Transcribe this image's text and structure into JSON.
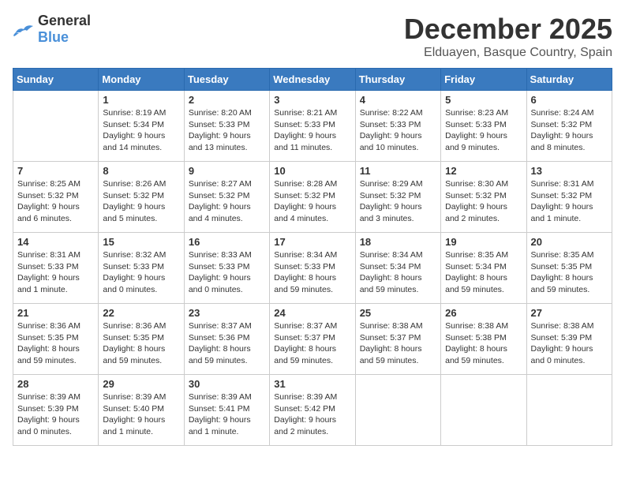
{
  "header": {
    "logo_general": "General",
    "logo_blue": "Blue",
    "month_title": "December 2025",
    "location": "Elduayen, Basque Country, Spain"
  },
  "days_of_week": [
    "Sunday",
    "Monday",
    "Tuesday",
    "Wednesday",
    "Thursday",
    "Friday",
    "Saturday"
  ],
  "weeks": [
    [
      {
        "day": "",
        "info": ""
      },
      {
        "day": "1",
        "info": "Sunrise: 8:19 AM\nSunset: 5:34 PM\nDaylight: 9 hours\nand 14 minutes."
      },
      {
        "day": "2",
        "info": "Sunrise: 8:20 AM\nSunset: 5:33 PM\nDaylight: 9 hours\nand 13 minutes."
      },
      {
        "day": "3",
        "info": "Sunrise: 8:21 AM\nSunset: 5:33 PM\nDaylight: 9 hours\nand 11 minutes."
      },
      {
        "day": "4",
        "info": "Sunrise: 8:22 AM\nSunset: 5:33 PM\nDaylight: 9 hours\nand 10 minutes."
      },
      {
        "day": "5",
        "info": "Sunrise: 8:23 AM\nSunset: 5:33 PM\nDaylight: 9 hours\nand 9 minutes."
      },
      {
        "day": "6",
        "info": "Sunrise: 8:24 AM\nSunset: 5:32 PM\nDaylight: 9 hours\nand 8 minutes."
      }
    ],
    [
      {
        "day": "7",
        "info": "Sunrise: 8:25 AM\nSunset: 5:32 PM\nDaylight: 9 hours\nand 6 minutes."
      },
      {
        "day": "8",
        "info": "Sunrise: 8:26 AM\nSunset: 5:32 PM\nDaylight: 9 hours\nand 5 minutes."
      },
      {
        "day": "9",
        "info": "Sunrise: 8:27 AM\nSunset: 5:32 PM\nDaylight: 9 hours\nand 4 minutes."
      },
      {
        "day": "10",
        "info": "Sunrise: 8:28 AM\nSunset: 5:32 PM\nDaylight: 9 hours\nand 4 minutes."
      },
      {
        "day": "11",
        "info": "Sunrise: 8:29 AM\nSunset: 5:32 PM\nDaylight: 9 hours\nand 3 minutes."
      },
      {
        "day": "12",
        "info": "Sunrise: 8:30 AM\nSunset: 5:32 PM\nDaylight: 9 hours\nand 2 minutes."
      },
      {
        "day": "13",
        "info": "Sunrise: 8:31 AM\nSunset: 5:32 PM\nDaylight: 9 hours\nand 1 minute."
      }
    ],
    [
      {
        "day": "14",
        "info": "Sunrise: 8:31 AM\nSunset: 5:33 PM\nDaylight: 9 hours\nand 1 minute."
      },
      {
        "day": "15",
        "info": "Sunrise: 8:32 AM\nSunset: 5:33 PM\nDaylight: 9 hours\nand 0 minutes."
      },
      {
        "day": "16",
        "info": "Sunrise: 8:33 AM\nSunset: 5:33 PM\nDaylight: 9 hours\nand 0 minutes."
      },
      {
        "day": "17",
        "info": "Sunrise: 8:34 AM\nSunset: 5:33 PM\nDaylight: 8 hours\nand 59 minutes."
      },
      {
        "day": "18",
        "info": "Sunrise: 8:34 AM\nSunset: 5:34 PM\nDaylight: 8 hours\nand 59 minutes."
      },
      {
        "day": "19",
        "info": "Sunrise: 8:35 AM\nSunset: 5:34 PM\nDaylight: 8 hours\nand 59 minutes."
      },
      {
        "day": "20",
        "info": "Sunrise: 8:35 AM\nSunset: 5:35 PM\nDaylight: 8 hours\nand 59 minutes."
      }
    ],
    [
      {
        "day": "21",
        "info": "Sunrise: 8:36 AM\nSunset: 5:35 PM\nDaylight: 8 hours\nand 59 minutes."
      },
      {
        "day": "22",
        "info": "Sunrise: 8:36 AM\nSunset: 5:35 PM\nDaylight: 8 hours\nand 59 minutes."
      },
      {
        "day": "23",
        "info": "Sunrise: 8:37 AM\nSunset: 5:36 PM\nDaylight: 8 hours\nand 59 minutes."
      },
      {
        "day": "24",
        "info": "Sunrise: 8:37 AM\nSunset: 5:37 PM\nDaylight: 8 hours\nand 59 minutes."
      },
      {
        "day": "25",
        "info": "Sunrise: 8:38 AM\nSunset: 5:37 PM\nDaylight: 8 hours\nand 59 minutes."
      },
      {
        "day": "26",
        "info": "Sunrise: 8:38 AM\nSunset: 5:38 PM\nDaylight: 8 hours\nand 59 minutes."
      },
      {
        "day": "27",
        "info": "Sunrise: 8:38 AM\nSunset: 5:39 PM\nDaylight: 9 hours\nand 0 minutes."
      }
    ],
    [
      {
        "day": "28",
        "info": "Sunrise: 8:39 AM\nSunset: 5:39 PM\nDaylight: 9 hours\nand 0 minutes."
      },
      {
        "day": "29",
        "info": "Sunrise: 8:39 AM\nSunset: 5:40 PM\nDaylight: 9 hours\nand 1 minute."
      },
      {
        "day": "30",
        "info": "Sunrise: 8:39 AM\nSunset: 5:41 PM\nDaylight: 9 hours\nand 1 minute."
      },
      {
        "day": "31",
        "info": "Sunrise: 8:39 AM\nSunset: 5:42 PM\nDaylight: 9 hours\nand 2 minutes."
      },
      {
        "day": "",
        "info": ""
      },
      {
        "day": "",
        "info": ""
      },
      {
        "day": "",
        "info": ""
      }
    ]
  ]
}
